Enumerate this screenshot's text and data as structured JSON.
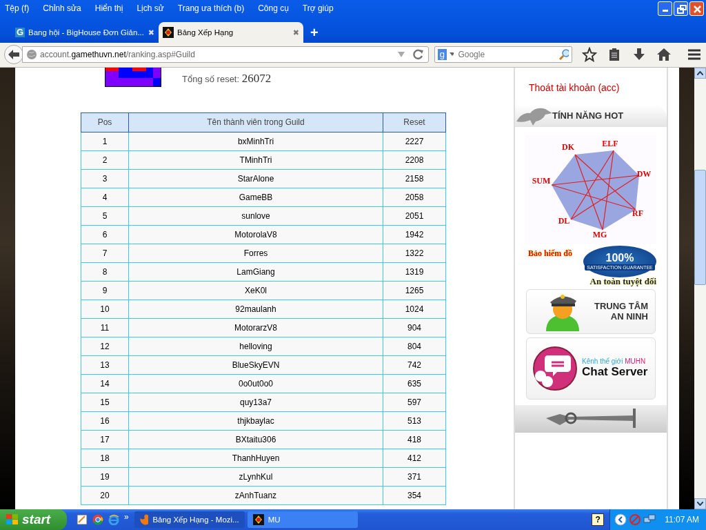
{
  "menu": [
    "Tệp (f)",
    "Chỉnh sửa",
    "Hiển thị",
    "Lịch sử",
    "Trang ưa thích (b)",
    "Công cụ",
    "Trợ giúp"
  ],
  "tabs": [
    {
      "label": "Bang hội - BigHouse Đơn Giản...",
      "selected": false,
      "icon": "G",
      "close": "✖"
    },
    {
      "label": "Bảng Xếp Hạng",
      "selected": true,
      "close": "✖"
    }
  ],
  "new_tab": "+",
  "address": {
    "prefix": "account.",
    "domain": "gamethuvn.net",
    "path": "/ranking.asp#Guild"
  },
  "search": {
    "placeholder": "Google",
    "engine": "g"
  },
  "guild": {
    "total_label": "Tổng số reset:",
    "total_value": "26072"
  },
  "table": {
    "columns": [
      "Pos",
      "Tên thành viên trong Guild",
      "Reset"
    ],
    "rows": [
      [
        "1",
        "bxMinhTri",
        "2227"
      ],
      [
        "2",
        "TMinhTri",
        "2208"
      ],
      [
        "3",
        "StarAlone",
        "2158"
      ],
      [
        "4",
        "GameBB",
        "2058"
      ],
      [
        "5",
        "sunlove",
        "2051"
      ],
      [
        "6",
        "MotorolaV8",
        "1942"
      ],
      [
        "7",
        "Forres",
        "1322"
      ],
      [
        "8",
        "LamGiang",
        "1319"
      ],
      [
        "9",
        "XeK0l",
        "1265"
      ],
      [
        "10",
        "92maulanh",
        "1024"
      ],
      [
        "11",
        "MotorarzV8",
        "904"
      ],
      [
        "12",
        "helloving",
        "804"
      ],
      [
        "13",
        "BlueSkyEVN",
        "742"
      ],
      [
        "14",
        "0o0ut0o0",
        "635"
      ],
      [
        "15",
        "quy13a7",
        "597"
      ],
      [
        "16",
        "thjkbaylac",
        "513"
      ],
      [
        "17",
        "BXtaitu306",
        "418"
      ],
      [
        "18",
        "ThanhHuyen",
        "412"
      ],
      [
        "19",
        "zLynhKul",
        "371"
      ],
      [
        "20",
        "zAnhTuanz",
        "354"
      ]
    ]
  },
  "sidebar": {
    "links": [
      "Thoát tài khoản (acc)"
    ],
    "hot_title": "TÍNH NĂNG HOT",
    "classes": [
      "DK",
      "ELF",
      "DW",
      "RF",
      "MG",
      "DL",
      "SUM"
    ],
    "insurance": {
      "title": "Bảo hiểm đồ",
      "seal": "100%",
      "seal_caption": "SATISFACTION GUARANTEE",
      "subtitle": "An toàn tuyệt đối"
    },
    "security": [
      "TRUNG TÂM",
      "AN NINH"
    ],
    "chat": {
      "channel": "Kênh thế giới",
      "channel_name": "MUHN",
      "title": "Chat Server"
    }
  },
  "taskbar": {
    "start": "start",
    "quick_more": "»",
    "tasks": [
      {
        "label": "Bảng Xếp Hạng - Mozi...",
        "selected": true
      },
      {
        "label": "MU",
        "selected": false
      }
    ],
    "help": "?",
    "time": "11:07 AM"
  }
}
